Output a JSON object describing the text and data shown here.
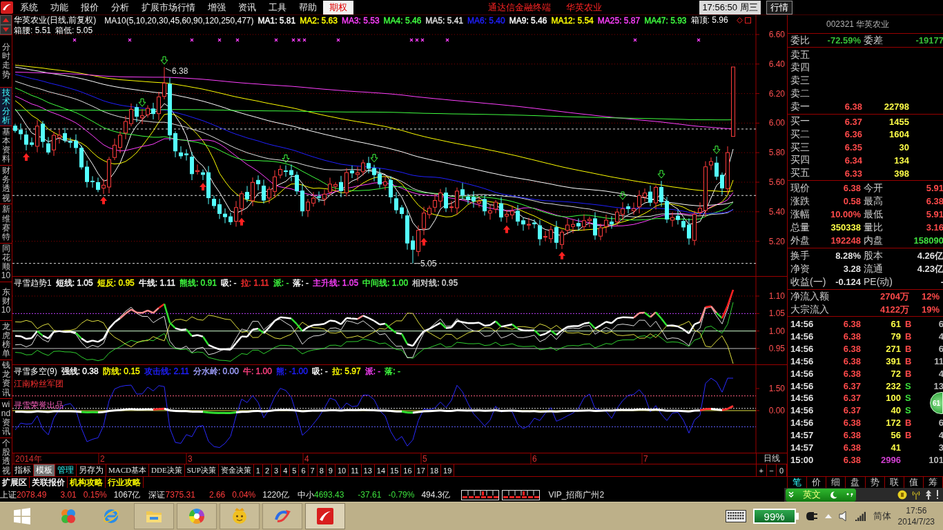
{
  "menu_bar": {
    "items": [
      {
        "label": "系统",
        "selected": false
      },
      {
        "label": "功能",
        "selected": false
      },
      {
        "label": "报价",
        "selected": false
      },
      {
        "label": "分析",
        "selected": false
      },
      {
        "label": "扩展市场行情",
        "selected": false
      },
      {
        "label": "增强",
        "selected": false
      },
      {
        "label": "资讯",
        "selected": false
      },
      {
        "label": "工具",
        "selected": false
      },
      {
        "label": "帮助",
        "selected": false
      },
      {
        "label": "期权",
        "selected": true
      }
    ],
    "app_title": "通达信金融终端",
    "stock_name": "华英农业",
    "clock": "17:56:50",
    "weekday": "周三",
    "quote_button": "行情"
  },
  "side_tabs": [
    {
      "label": "分时走势",
      "selected": false
    },
    {
      "label": "技术分析",
      "selected": true
    },
    {
      "label": "基本资料",
      "selected": false
    },
    {
      "label": "财务透视",
      "selected": false
    },
    {
      "label": "新维赛特",
      "selected": false
    },
    {
      "label": "同花顺10",
      "selected": false
    },
    {
      "label": "东财10",
      "selected": false
    },
    {
      "label": "龙虎榜单",
      "selected": false
    },
    {
      "label": "钱龙资讯",
      "selected": false
    },
    {
      "label": "wind资讯",
      "selected": false
    },
    {
      "label": "个股透视",
      "selected": false
    }
  ],
  "chart_header": {
    "title": "华英农业(日线,前复权)",
    "ma_params": "MA10(5,10,20,30,45,60,90,120,250,477)",
    "ma_values": [
      {
        "text": "MA1: 5.81",
        "color": "#ffffff"
      },
      {
        "text": "MA2: 5.63",
        "color": "#ffff00"
      },
      {
        "text": "MA3: 5.53",
        "color": "#ff40ff"
      },
      {
        "text": "MA4: 5.46",
        "color": "#40ff40"
      },
      {
        "text": "MA5: 5.41",
        "color": "#e0e0e0"
      },
      {
        "text": "MA6: 5.40",
        "color": "#2020ff"
      },
      {
        "text": "MA9: 5.46",
        "color": "#ffffff"
      },
      {
        "text": "MA12: 5.54",
        "color": "#ffff00"
      },
      {
        "text": "MA25: 5.87",
        "color": "#ff40ff"
      },
      {
        "text": "MA47: 5.93",
        "color": "#40ff40"
      }
    ],
    "box_top": "箱顶: 5.96",
    "box_middle": "箱腰: 5.51",
    "box_low": "箱低: 5.05"
  },
  "main_chart": {
    "y_labels": [
      "6.60",
      "6.40",
      "6.20",
      "6.00",
      "5.80",
      "5.60",
      "5.40",
      "5.20"
    ],
    "high_label": "6.38",
    "low_label": "5.05"
  },
  "trend_indicator": {
    "name": "寻雪趋势1",
    "values": [
      {
        "text": "短线: 1.05",
        "color": "#ffffff"
      },
      {
        "text": "短反: 0.95",
        "color": "#ffff00"
      },
      {
        "text": "牛线: 1.11",
        "color": "#ffffff"
      },
      {
        "text": "熊线: 0.91",
        "color": "#40ff40"
      },
      {
        "text": "吸: -",
        "color": "#ffffff"
      },
      {
        "text": "拉: 1.11",
        "color": "#ff3030"
      },
      {
        "text": "派: -",
        "color": "#40ff40"
      },
      {
        "text": "落: -",
        "color": "#ffffff"
      },
      {
        "text": "主升线: 1.05",
        "color": "#ff40ff"
      },
      {
        "text": "中间线: 1.00",
        "color": "#40ff40"
      },
      {
        "text": "相对线: 0.95",
        "color": "#d0d0d0"
      }
    ],
    "y_labels": [
      "1.10",
      "1.05",
      "1.00",
      "0.95"
    ]
  },
  "strength_indicator": {
    "name": "寻雪多空(9)",
    "values": [
      {
        "text": "强线: 0.38",
        "color": "#ffffff"
      },
      {
        "text": "防线: 0.15",
        "color": "#ffff00"
      },
      {
        "text": "攻击线: 2.11",
        "color": "#2020ff"
      },
      {
        "text": "分水岭: 0.00",
        "color": "#a0a0ff"
      },
      {
        "text": "牛: 1.00",
        "color": "#ff4080"
      },
      {
        "text": "熊: -1.00",
        "color": "#2020ff"
      },
      {
        "text": "吸: -",
        "color": "#ffffff"
      },
      {
        "text": "拉: 5.97",
        "color": "#ffff00"
      },
      {
        "text": "派: -",
        "color": "#ff40ff"
      },
      {
        "text": "落: -",
        "color": "#40ff40"
      }
    ],
    "legend": "江南粉丝军团",
    "credit": "寻雪荣誉出品",
    "y_labels": [
      "1.50",
      "0.00"
    ]
  },
  "date_axis": {
    "labels": [
      "2014年",
      "2",
      "3",
      "4",
      "5",
      "6",
      "7"
    ],
    "period": "日线",
    "zoom_buttons": [
      "+",
      "−",
      "0"
    ]
  },
  "toolbar": {
    "items": [
      {
        "label": "指标",
        "kind": "plain",
        "selected": false
      },
      {
        "label": "模板",
        "kind": "plain",
        "selected": true
      },
      {
        "label": "管理",
        "kind": "accent",
        "selected": false
      },
      {
        "label": "另存为",
        "kind": "plain",
        "selected": false
      },
      {
        "label": "MACD基本",
        "kind": "template",
        "selected": false
      },
      {
        "label": "DDE决策",
        "kind": "template",
        "selected": false
      },
      {
        "label": "SUP决策",
        "kind": "template",
        "selected": false
      },
      {
        "label": "资金决策",
        "kind": "template",
        "selected": false
      }
    ],
    "pages": [
      "1",
      "2",
      "3",
      "4",
      "5",
      "6",
      "7",
      "8",
      "9",
      "10",
      "11",
      "13",
      "14",
      "15",
      "16",
      "17",
      "18",
      "19"
    ]
  },
  "extension_tabs": [
    {
      "label": "扩展区",
      "color": "#ffffff"
    },
    {
      "label": "关联报价",
      "color": "#ffffff"
    },
    {
      "label": "机构攻略",
      "color": "#ffff00"
    },
    {
      "label": "行业攻略",
      "color": "#ffff00"
    }
  ],
  "quote_panel": {
    "title": "002321 华英农业",
    "order_ratio": [
      {
        "label": "委比",
        "value": "-72.59%",
        "color": "#38c038"
      },
      {
        "label": "委差",
        "value": "-19177",
        "color": "#38c038"
      }
    ],
    "asks": [
      {
        "label": "卖五"
      },
      {
        "label": "卖四"
      },
      {
        "label": "卖三"
      },
      {
        "label": "卖二"
      },
      {
        "label": "卖一",
        "price": "6.38",
        "volume": "22798"
      }
    ],
    "bids": [
      {
        "label": "买一",
        "price": "6.37",
        "volume": "1455"
      },
      {
        "label": "买二",
        "price": "6.36",
        "volume": "1604"
      },
      {
        "label": "买三",
        "price": "6.35",
        "volume": "30"
      },
      {
        "label": "买四",
        "price": "6.34",
        "volume": "134"
      },
      {
        "label": "买五",
        "price": "6.33",
        "volume": "398"
      }
    ],
    "stats": [
      {
        "label": "现价",
        "value": "6.38",
        "color": "#ff4a4a"
      },
      {
        "label": "今开",
        "value": "5.91",
        "color": "#ff4a4a"
      },
      {
        "label": "涨跌",
        "value": "0.58",
        "color": "#ff4a4a"
      },
      {
        "label": "最高",
        "value": "6.38",
        "color": "#ff4a4a"
      },
      {
        "label": "涨幅",
        "value": "10.00%",
        "color": "#ff4a4a"
      },
      {
        "label": "最低",
        "value": "5.91",
        "color": "#ff4a4a"
      },
      {
        "label": "总量",
        "value": "350338",
        "color": "#ffff48"
      },
      {
        "label": "量比",
        "value": "3.16",
        "color": "#ff4a4a"
      },
      {
        "label": "外盘",
        "value": "192248",
        "color": "#ff4a4a"
      },
      {
        "label": "内盘",
        "value": "158090",
        "color": "#40e040"
      }
    ],
    "fundamentals": [
      {
        "label": "换手",
        "value": "8.28%"
      },
      {
        "label": "股本",
        "value": "4.26亿"
      },
      {
        "label": "净资",
        "value": "3.28"
      },
      {
        "label": "流通",
        "value": "4.23亿"
      },
      {
        "label": "收益(一)",
        "value": "-0.124"
      },
      {
        "label": "PE(动)",
        "value": "-"
      }
    ],
    "fund_flows": [
      {
        "label": "净流入额",
        "value": "2704万",
        "share": "12%"
      },
      {
        "label": "大宗流入",
        "value": "4122万",
        "share": "19%"
      }
    ]
  },
  "trades": [
    {
      "time": "14:56",
      "price": "6.38",
      "volume": "61",
      "side": "B",
      "kind": "buy",
      "count": "6"
    },
    {
      "time": "14:56",
      "price": "6.38",
      "volume": "79",
      "side": "B",
      "kind": "buy",
      "count": "4"
    },
    {
      "time": "14:56",
      "price": "6.38",
      "volume": "271",
      "side": "B",
      "kind": "buy",
      "count": "6"
    },
    {
      "time": "14:56",
      "price": "6.38",
      "volume": "391",
      "side": "B",
      "kind": "buy",
      "count": "11"
    },
    {
      "time": "14:56",
      "price": "6.38",
      "volume": "72",
      "side": "B",
      "kind": "buy",
      "count": "4"
    },
    {
      "time": "14:56",
      "price": "6.37",
      "volume": "232",
      "side": "S",
      "kind": "sell",
      "count": "13"
    },
    {
      "time": "14:56",
      "price": "6.37",
      "volume": "100",
      "side": "S",
      "kind": "sell"
    },
    {
      "time": "14:56",
      "price": "6.37",
      "volume": "40",
      "side": "S",
      "kind": "sell"
    },
    {
      "time": "14:56",
      "price": "6.38",
      "volume": "172",
      "side": "B",
      "kind": "buy",
      "count": "6"
    },
    {
      "time": "14:57",
      "price": "6.38",
      "volume": "56",
      "side": "B",
      "kind": "buy",
      "count": "4"
    },
    {
      "time": "14:57",
      "price": "6.38",
      "volume": "41",
      "kind": "none",
      "count": "3"
    },
    {
      "time": "15:00",
      "price": "6.38",
      "volume": "2996",
      "kind": "close",
      "count": "101"
    }
  ],
  "quote_tabs": [
    {
      "label": "笔",
      "selected": true
    },
    {
      "label": "价",
      "selected": false
    },
    {
      "label": "细",
      "selected": false
    },
    {
      "label": "盘",
      "selected": false
    },
    {
      "label": "势",
      "selected": false
    },
    {
      "label": "联",
      "selected": false
    },
    {
      "label": "值",
      "selected": false
    },
    {
      "label": "筹",
      "selected": false
    }
  ],
  "status_bar": {
    "indices": [
      {
        "name": "上证",
        "value": "2078.49",
        "change": "3.01",
        "percent": "0.15%",
        "amount": "1067亿",
        "color": "#ff3c3c"
      },
      {
        "name": "深证",
        "value": "7375.31",
        "change": "2.66",
        "percent": "0.04%",
        "amount": "1220亿",
        "color": "#ff3c3c"
      },
      {
        "name": "中小",
        "value": "4693.43",
        "change": "-37.61",
        "percent": "-0.79%",
        "amount": "494.3亿",
        "color": "#3ce03c"
      }
    ],
    "account": "VIP_招商广州2",
    "ime_mode": "英文"
  },
  "taskbar": {
    "apps": [
      {
        "running": false,
        "selected": false
      },
      {
        "running": false,
        "selected": false
      },
      {
        "running": true,
        "selected": false
      },
      {
        "running": true,
        "selected": false
      },
      {
        "running": true,
        "selected": false
      },
      {
        "running": true,
        "selected": false
      },
      {
        "running": true,
        "selected": true
      }
    ],
    "battery": "99%",
    "language": "简体",
    "time": "17:56",
    "date": "2014/7/23"
  },
  "floating_ball": "61"
}
